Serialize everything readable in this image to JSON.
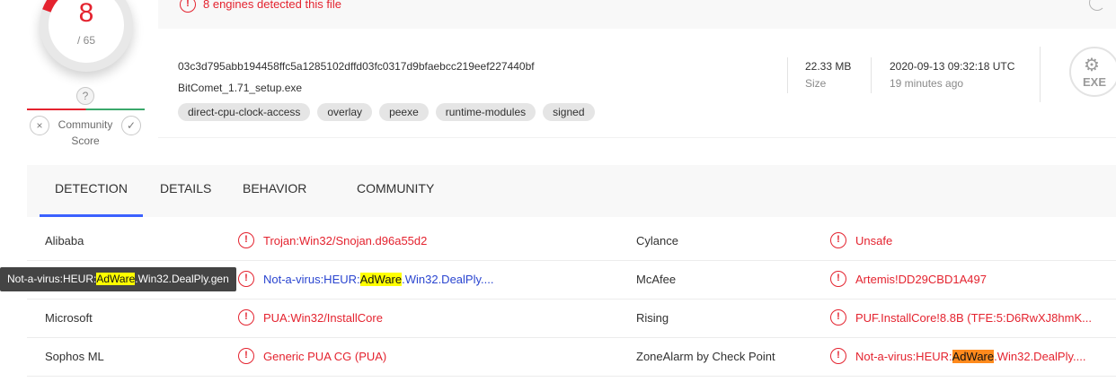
{
  "score": {
    "detections": "8",
    "total": "/ 65"
  },
  "community": {
    "question": "?",
    "label": "Community Score",
    "dislike": "×",
    "like": "✓"
  },
  "banner": {
    "text": "8 engines detected this file"
  },
  "file": {
    "hash": "03c3d795abb194458ffc5a1285102dffd03fc0317d9bfaebcc219eef227440bf",
    "name": "BitComet_1.71_setup.exe",
    "tags": [
      "direct-cpu-clock-access",
      "overlay",
      "peexe",
      "runtime-modules",
      "signed"
    ],
    "size_value": "22.33 MB",
    "size_label": "Size",
    "date_value": "2020-09-13 09:32:18 UTC",
    "date_label": "19 minutes ago",
    "type_badge": "EXE"
  },
  "tabs": [
    "DETECTION",
    "DETAILS",
    "BEHAVIOR",
    "COMMUNITY"
  ],
  "rows": [
    {
      "left_engine": "Alibaba",
      "left_result": {
        "pre": "Trojan:Win32/Snojan.d96a55d2",
        "hl": "",
        "post": ""
      },
      "right_engine": "Cylance",
      "right_result": {
        "pre": "Unsafe",
        "hl": "",
        "post": ""
      }
    },
    {
      "left_engine": "",
      "left_result": {
        "pre": "Not-a-virus:HEUR:",
        "hl": "AdWare",
        "post": ".Win32.DealPly...."
      },
      "right_engine": "McAfee",
      "right_result": {
        "pre": "Artemis!DD29CBD1A497",
        "hl": "",
        "post": ""
      }
    },
    {
      "left_engine": "Microsoft",
      "left_result": {
        "pre": "PUA:Win32/InstallCore",
        "hl": "",
        "post": ""
      },
      "right_engine": "Rising",
      "right_result": {
        "pre": "PUF.InstallCore!8.8B (TFE:5:D6RwXJ8hmK...",
        "hl": "",
        "post": ""
      }
    },
    {
      "left_engine": "Sophos ML",
      "left_result": {
        "pre": "Generic PUA CG (PUA)",
        "hl": "",
        "post": ""
      },
      "right_engine": "ZoneAlarm by Check Point",
      "right_result": {
        "pre": "Not-a-virus:HEUR:",
        "hl": "AdWare",
        "post": ".Win32.DealPly...."
      }
    }
  ],
  "tooltip": {
    "pre": "Not-a-virus:HEUR:",
    "hl": "AdWare",
    "post": ".Win32.DealPly.gen"
  },
  "colors": {
    "danger": "#e4232f",
    "accent": "#3b61ff",
    "link": "#2a45d0",
    "highlight_yellow": "#ffff00",
    "highlight_orange": "#ff8a1d"
  },
  "icons": {
    "alert": "alert-circle-icon",
    "reload": "reload-icon",
    "exe": "exe-file-icon"
  }
}
